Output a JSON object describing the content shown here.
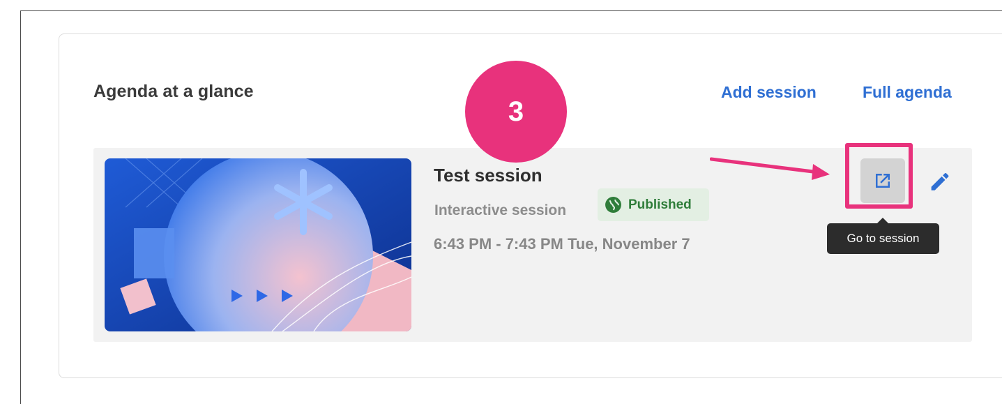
{
  "agenda": {
    "title": "Agenda at a glance",
    "add_session_label": "Add session",
    "full_agenda_label": "Full agenda"
  },
  "session": {
    "title": "Test session",
    "type": "Interactive session",
    "status": "Published",
    "time": "6:43 PM - 7:43 PM  Tue, November 7",
    "actions": {
      "go_icon": "open-in-new-icon",
      "edit_icon": "pencil-icon"
    }
  },
  "tooltip": {
    "text": "Go to session"
  },
  "annotation": {
    "step_number": "3"
  },
  "colors": {
    "link": "#2f6fd3",
    "highlight": "#e8327c",
    "published_bg": "#e3efe3",
    "published_text": "#2f7d3a"
  }
}
